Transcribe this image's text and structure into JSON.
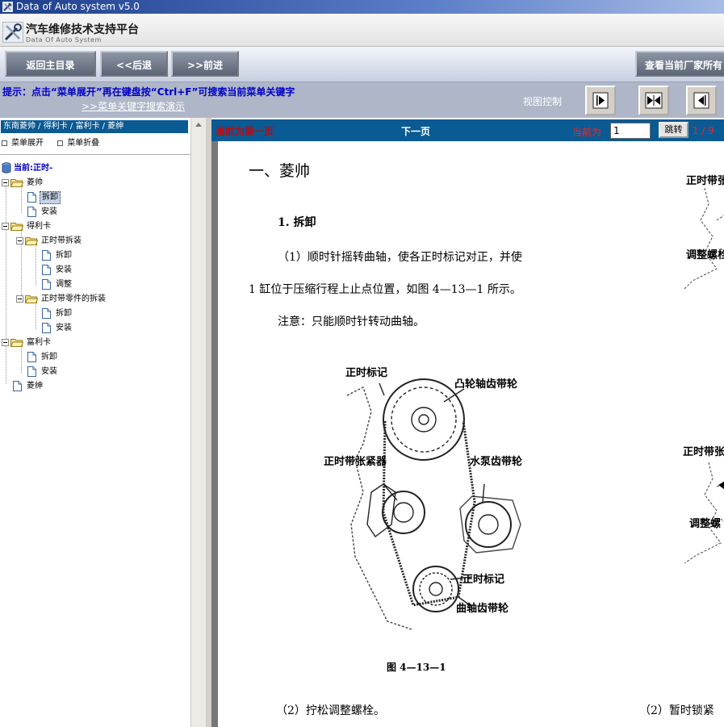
{
  "window": {
    "title": "Data of Auto system v5.0"
  },
  "header": {
    "title": "汽车维修技术支持平台",
    "subtitle": "Data Of Auto System"
  },
  "toolbar": {
    "home_label": "返回主目录",
    "back_label": "<<后退",
    "forward_label": ">>前进",
    "view_vendor_label": "查看当前厂家所有"
  },
  "hintbar": {
    "hint": "提示：点击“菜单展开”再在键盘按“Ctrl+F”可搜索当前菜单关键字",
    "demo_link": ">>菜单关键字搜索演示",
    "view_control": "视图控制"
  },
  "sidebar": {
    "breadcrumb": "东南菱帅 / 得利卡 / 富利卡 / 菱绅",
    "expand_label": "菜单展开",
    "collapse_label": "菜单折叠",
    "current_label": "当前:正时-",
    "tree": [
      {
        "label": "菱帅",
        "type": "folder"
      },
      {
        "label": "拆卸",
        "type": "doc",
        "selected": true
      },
      {
        "label": "安装",
        "type": "doc"
      },
      {
        "label": "得利卡",
        "type": "folder"
      },
      {
        "label": "正时带拆装",
        "type": "folder"
      },
      {
        "label": "拆卸",
        "type": "doc"
      },
      {
        "label": "安装",
        "type": "doc"
      },
      {
        "label": "调整",
        "type": "doc"
      },
      {
        "label": "正时带零件的拆装",
        "type": "folder"
      },
      {
        "label": "拆卸",
        "type": "doc"
      },
      {
        "label": "安装",
        "type": "doc"
      },
      {
        "label": "富利卡",
        "type": "folder"
      },
      {
        "label": "拆卸",
        "type": "doc"
      },
      {
        "label": "安装",
        "type": "doc"
      },
      {
        "label": "菱绅",
        "type": "doc"
      }
    ]
  },
  "pager": {
    "first_label": "当前为第一页",
    "next_label": "下一页",
    "current_prefix": "当前为",
    "page_value": "1",
    "jump_label": "跳转",
    "page_count": "1 / 9"
  },
  "document": {
    "heading": "一、菱帅",
    "section": "1. 拆卸",
    "para1": "（1）顺时针摇转曲轴，使各正时标记对正，并使",
    "para2": "1 缸位于压缩行程上止点位置，如图 4—13—1 所示。",
    "para3": "注意：只能顺时针转动曲轴。",
    "figure_caption": "图 4—13—1",
    "para4": "（2）拧松调整螺栓。",
    "para5": "（2）暂时锁紧",
    "diagram_labels": {
      "timing_mark_top": "正时标记",
      "cam_pulley": "凸轮轴齿带轮",
      "tensioner": "正时带张紧器",
      "water_pump_pulley": "水泵齿带轮",
      "timing_mark_bottom": "正时标记",
      "crank_pulley": "曲轴齿带轮"
    },
    "side_labels": {
      "s1": "正时带张",
      "s2": "调整螺栓",
      "s3": "正时带张",
      "s4": "调整螺"
    }
  }
}
